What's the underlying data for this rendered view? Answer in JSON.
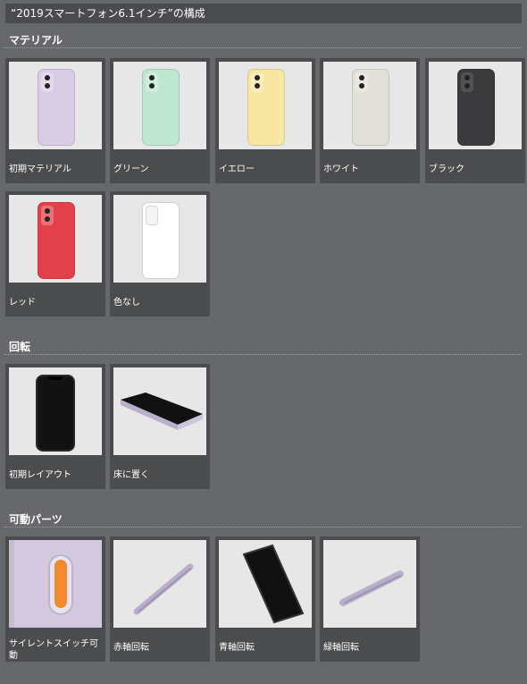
{
  "header": {
    "title": "“2019スマートフォン6.1インチ”の構成"
  },
  "sections": [
    {
      "title": "マテリアル",
      "items": [
        {
          "label": "初期マテリアル",
          "color": "#d9cde5",
          "icon": "phone-back"
        },
        {
          "label": "グリーン",
          "color": "#bfe6d2",
          "icon": "phone-back"
        },
        {
          "label": "イエロー",
          "color": "#f7e7a3",
          "icon": "phone-back"
        },
        {
          "label": "ホワイト",
          "color": "#e3e0da",
          "icon": "phone-back"
        },
        {
          "label": "ブラック",
          "color": "#3b3b3d",
          "icon": "phone-back"
        },
        {
          "label": "レッド",
          "color": "#e2404b",
          "icon": "phone-back"
        },
        {
          "label": "色なし",
          "color": "#ffffff",
          "icon": "phone-back"
        }
      ]
    },
    {
      "title": "回転",
      "items": [
        {
          "label": "初期レイアウト",
          "icon": "phone-front"
        },
        {
          "label": "床に置く",
          "icon": "phone-flat"
        }
      ]
    },
    {
      "title": "可動パーツ",
      "items": [
        {
          "label": "サイレントスイッチ可動",
          "icon": "silent-switch"
        },
        {
          "label": "赤軸回転",
          "icon": "phone-edge-diagonal"
        },
        {
          "label": "青軸回転",
          "icon": "phone-front-tilted"
        },
        {
          "label": "緑軸回転",
          "icon": "phone-edge-diagonal"
        }
      ]
    }
  ]
}
